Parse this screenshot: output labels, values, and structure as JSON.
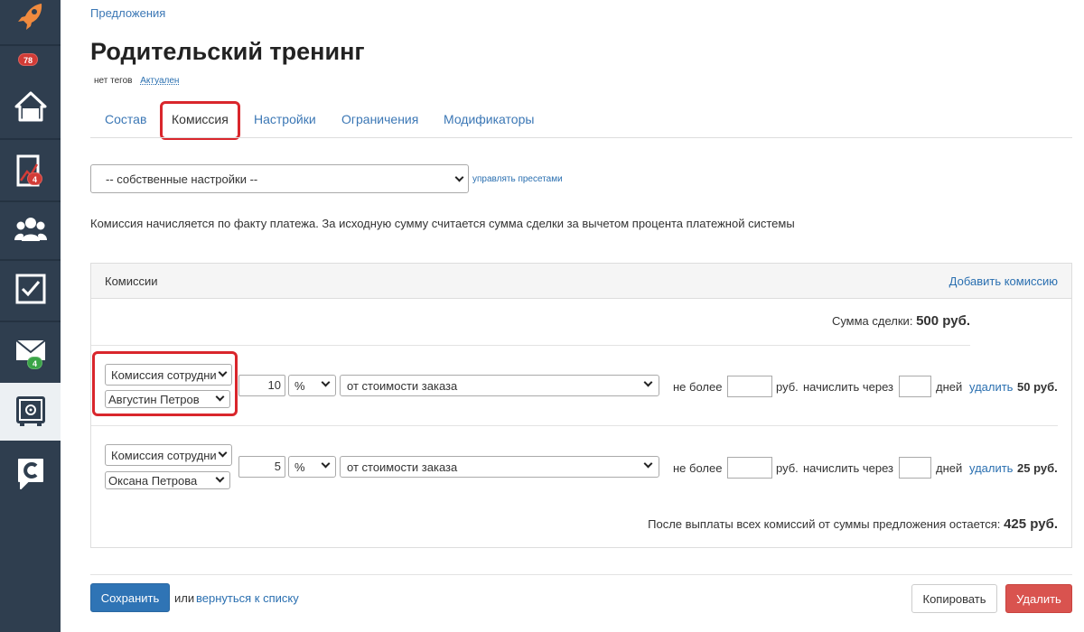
{
  "sidebar": {
    "items": [
      {
        "icon": "rocket-icon"
      },
      {
        "icon": "home-icon",
        "badge": "78"
      },
      {
        "icon": "chart-icon",
        "badge": "4"
      },
      {
        "icon": "users-icon"
      },
      {
        "icon": "checkbox-icon"
      },
      {
        "icon": "mail-icon",
        "badge": "4"
      },
      {
        "icon": "safe-icon"
      },
      {
        "icon": "chat-c-icon"
      }
    ]
  },
  "breadcrumb": "Предложения",
  "title": "Родительский тренинг",
  "tags": {
    "none": "нет тегов",
    "status": "Актуален"
  },
  "tabs": [
    "Состав",
    "Комиссия",
    "Настройки",
    "Ограничения",
    "Модификаторы"
  ],
  "preset": {
    "value": "-- собственные настройки --",
    "manage_link": "управлять пресетами"
  },
  "info": "Комиссия начисляется по факту платежа. За исходную сумму считается сумма сделки за вычетом процента платежной системы",
  "panel": {
    "title": "Комиссии",
    "add_link": "Добавить комиссию",
    "deal_sum_label": "Сумма сделки:",
    "deal_sum_value": "500 руб.",
    "rows": [
      {
        "type": "Комиссия сотрудни",
        "employee": "Августин Петров",
        "value": "10",
        "unit": "%",
        "base": "от стоимости заказа",
        "max_label": "не более",
        "currency": "руб.",
        "delay_label": "начислить через",
        "days": "дней",
        "delete": "удалить",
        "amount": "50 руб."
      },
      {
        "type": "Комиссия сотрудни",
        "employee": "Оксана Петрова",
        "value": "5",
        "unit": "%",
        "base": "от стоимости заказа",
        "max_label": "не более",
        "currency": "руб.",
        "delay_label": "начислить через",
        "days": "дней",
        "delete": "удалить",
        "amount": "25 руб."
      }
    ],
    "remain_label": "После выплаты всех комиссий от суммы предложения остается:",
    "remain_value": "425 руб."
  },
  "footer": {
    "save": "Сохранить",
    "or": "или",
    "back": "вернуться к списку",
    "copy": "Копировать",
    "delete": "Удалить"
  },
  "colors": {
    "sidebar": "#2f3e4f",
    "accent": "#2f74b5",
    "danger": "#d9534f",
    "highlight": "#d9262c"
  }
}
